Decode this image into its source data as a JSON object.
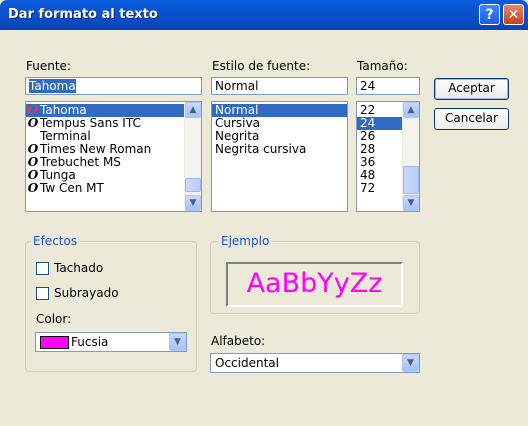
{
  "window": {
    "title": "Dar formato al texto",
    "help_glyph": "?",
    "close_glyph": "✕"
  },
  "font": {
    "label": "Fuente:",
    "value": "Tahoma",
    "items": [
      {
        "name": "Tahoma",
        "icon": "opentype-font-icon",
        "selected": true
      },
      {
        "name": "Tempus Sans ITC",
        "icon": "opentype-font-icon",
        "selected": false
      },
      {
        "name": "Terminal",
        "icon": "",
        "selected": false
      },
      {
        "name": "Times New Roman",
        "icon": "opentype-font-icon",
        "selected": false
      },
      {
        "name": "Trebuchet MS",
        "icon": "opentype-font-icon",
        "selected": false
      },
      {
        "name": "Tunga",
        "icon": "opentype-font-icon",
        "selected": false
      },
      {
        "name": "Tw Cen MT",
        "icon": "opentype-font-icon",
        "selected": false
      }
    ]
  },
  "style": {
    "label": "Estilo de fuente:",
    "value": "Normal",
    "items": [
      "Normal",
      "Cursiva",
      "Negrita",
      "Negrita cursiva"
    ],
    "selected_index": 0
  },
  "size": {
    "label": "Tamaño:",
    "value": "24",
    "items": [
      "22",
      "24",
      "26",
      "28",
      "36",
      "48",
      "72"
    ],
    "selected_index": 1
  },
  "buttons": {
    "ok": "Aceptar",
    "cancel": "Cancelar"
  },
  "effects": {
    "title": "Efectos",
    "strikeout": {
      "label": "Tachado",
      "checked": false
    },
    "underline": {
      "label": "Subrayado",
      "checked": false
    },
    "color_label": "Color:",
    "color_value": "Fucsia",
    "color_swatch": "#ff00ff"
  },
  "sample": {
    "title": "Ejemplo",
    "text": "AaBbYyZz",
    "color": "#ff00ff"
  },
  "script": {
    "label": "Alfabeto:",
    "value": "Occidental"
  },
  "arrows": {
    "up": "▲",
    "down": "▼"
  }
}
